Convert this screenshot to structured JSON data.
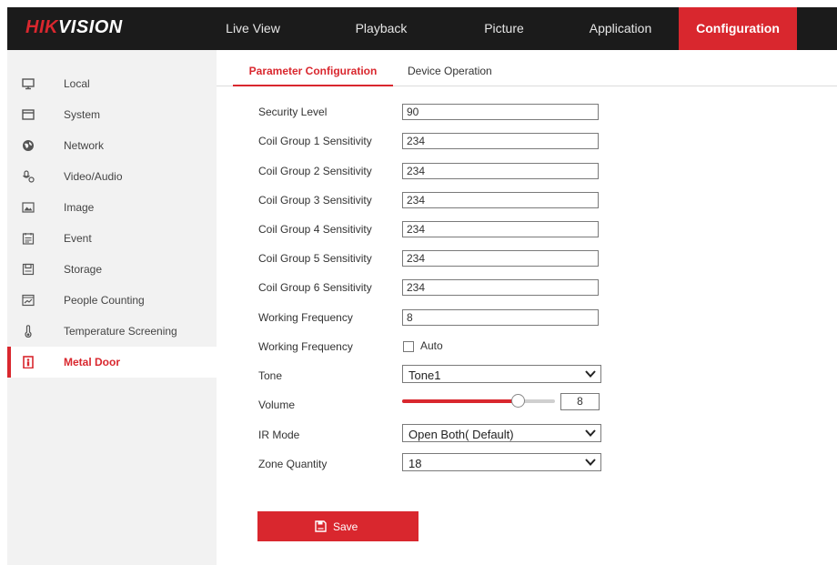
{
  "brand": {
    "name_red": "HIK",
    "name_white": "VISION"
  },
  "nav": {
    "live_view": "Live View",
    "playback": "Playback",
    "picture": "Picture",
    "application": "Application",
    "configuration": "Configuration"
  },
  "sidebar": {
    "items": [
      {
        "label": "Local",
        "icon": "monitor-icon"
      },
      {
        "label": "System",
        "icon": "system-icon"
      },
      {
        "label": "Network",
        "icon": "globe-icon"
      },
      {
        "label": "Video/Audio",
        "icon": "video-audio-icon"
      },
      {
        "label": "Image",
        "icon": "image-icon"
      },
      {
        "label": "Event",
        "icon": "calendar-icon"
      },
      {
        "label": "Storage",
        "icon": "storage-icon"
      },
      {
        "label": "People Counting",
        "icon": "people-counting-icon"
      },
      {
        "label": "Temperature Screening",
        "icon": "thermometer-icon"
      },
      {
        "label": "Metal Door",
        "icon": "metal-door-icon"
      }
    ],
    "active_index": 9
  },
  "tabs": {
    "param_config": "Parameter Configuration",
    "device_op": "Device Operation"
  },
  "form": {
    "security_level": {
      "label": "Security Level",
      "value": "90"
    },
    "coil_groups": [
      {
        "label": "Coil Group 1 Sensitivity",
        "value": "234"
      },
      {
        "label": "Coil Group 2 Sensitivity",
        "value": "234"
      },
      {
        "label": "Coil Group 3 Sensitivity",
        "value": "234"
      },
      {
        "label": "Coil Group 4 Sensitivity",
        "value": "234"
      },
      {
        "label": "Coil Group 5 Sensitivity",
        "value": "234"
      },
      {
        "label": "Coil Group 6 Sensitivity",
        "value": "234"
      }
    ],
    "working_frequency": {
      "label": "Working Frequency",
      "value": "8"
    },
    "working_frequency_auto": {
      "label": "Working Frequency",
      "checkbox_label": "Auto",
      "checked": false
    },
    "tone": {
      "label": "Tone",
      "value": "Tone1"
    },
    "volume": {
      "label": "Volume",
      "value": "8",
      "fraction": 0.76
    },
    "ir_mode": {
      "label": "IR Mode",
      "value": "Open Both( Default)"
    },
    "zone_quantity": {
      "label": "Zone Quantity",
      "value": "18"
    }
  },
  "actions": {
    "save_label": "Save"
  },
  "colors": {
    "accent": "#d9272e",
    "topbar": "#1b1b1b",
    "sidebar_bg": "#f2f2f2"
  }
}
